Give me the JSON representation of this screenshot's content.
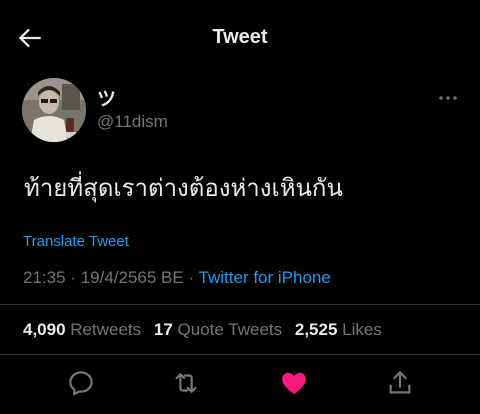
{
  "header": {
    "title": "Tweet",
    "back_icon": "back-arrow-icon"
  },
  "author": {
    "display_name": "ツ",
    "handle": "@11dism",
    "avatar_icon": "avatar"
  },
  "tweet": {
    "text": "ท้ายที่สุดเราต่างต้องห่างเหินกัน",
    "translate_label": "Translate Tweet",
    "time": "21:35",
    "date": "19/4/2565 BE",
    "source": "Twitter for iPhone",
    "separator": "·"
  },
  "stats": {
    "retweets_count": "4,090",
    "retweets_label": "Retweets",
    "quote_count": "17",
    "quote_label": "Quote Tweets",
    "likes_count": "2,525",
    "likes_label": "Likes"
  },
  "actions": {
    "reply_icon": "reply-icon",
    "retweet_icon": "retweet-icon",
    "like_icon": "heart-icon",
    "like_active": true,
    "share_icon": "share-icon"
  },
  "colors": {
    "background": "#000000",
    "text": "#e7e9ea",
    "muted": "#71767b",
    "link": "#1d9bf0",
    "like": "#f91880",
    "divider": "#2f3336"
  }
}
